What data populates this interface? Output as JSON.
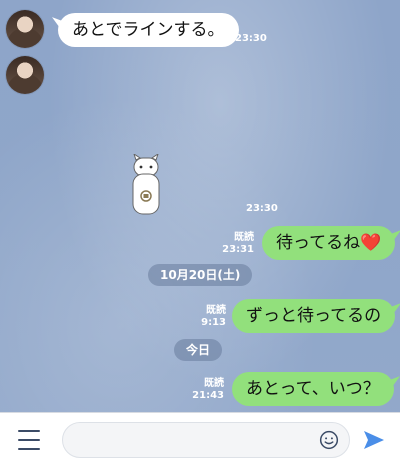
{
  "messages": [
    {
      "side": "in",
      "text": "あとでラインする。",
      "time": "23:30"
    },
    {
      "side": "in",
      "type": "sticker",
      "time": "23:30"
    },
    {
      "side": "out",
      "text": "待ってるね❤️",
      "read": "既読",
      "time": "23:31"
    },
    {
      "side": "out",
      "text": "ずっと待ってるの",
      "read": "既読",
      "time": "9:13"
    },
    {
      "side": "out",
      "text": "あとって、いつ？",
      "read": "既読",
      "time": "21:43"
    }
  ],
  "dates": {
    "date_1": "10月20日(土)",
    "date_2": "今日"
  },
  "composer": {
    "placeholder": ""
  },
  "colors": {
    "background": "#8fa6c9",
    "outgoing": "#92e07c",
    "incoming": "#ffffff"
  },
  "icons": {
    "menu": "menu-icon",
    "emoji": "emoji-icon",
    "send": "send-icon"
  }
}
